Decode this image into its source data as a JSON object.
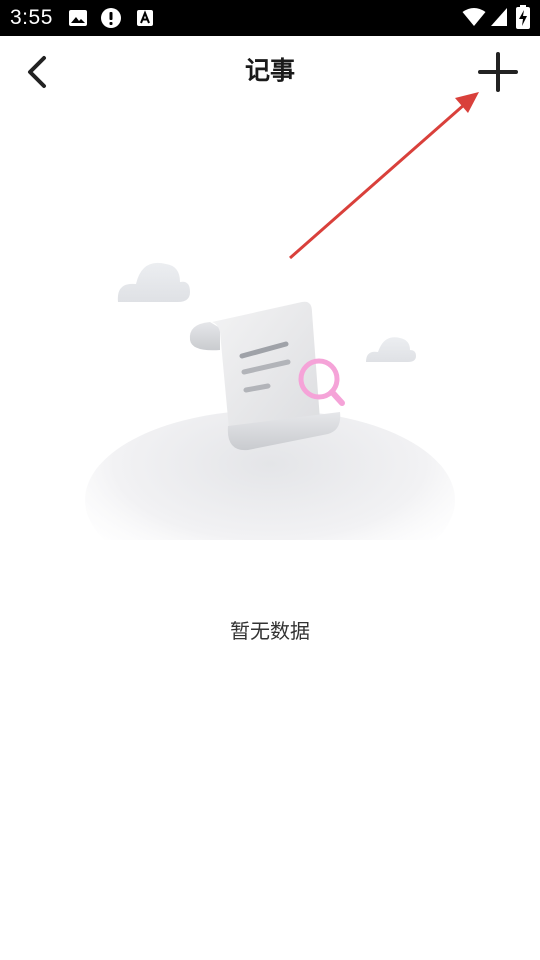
{
  "status_bar": {
    "time": "3:55",
    "icons": [
      "image-icon",
      "alert-icon",
      "font-icon",
      "wifi-icon",
      "signal-icon",
      "battery-charging-icon"
    ]
  },
  "nav": {
    "title": "记事",
    "back_icon": "chevron-left-icon",
    "add_icon": "plus-icon"
  },
  "empty_state": {
    "message": "暂无数据",
    "illustration": "scroll-search-illustration"
  },
  "colors": {
    "status_bar_bg": "#000000",
    "background": "#ffffff",
    "title_text": "#1a1a1a",
    "annotation_arrow": "#d9403b",
    "search_accent": "#f5a3d8"
  }
}
